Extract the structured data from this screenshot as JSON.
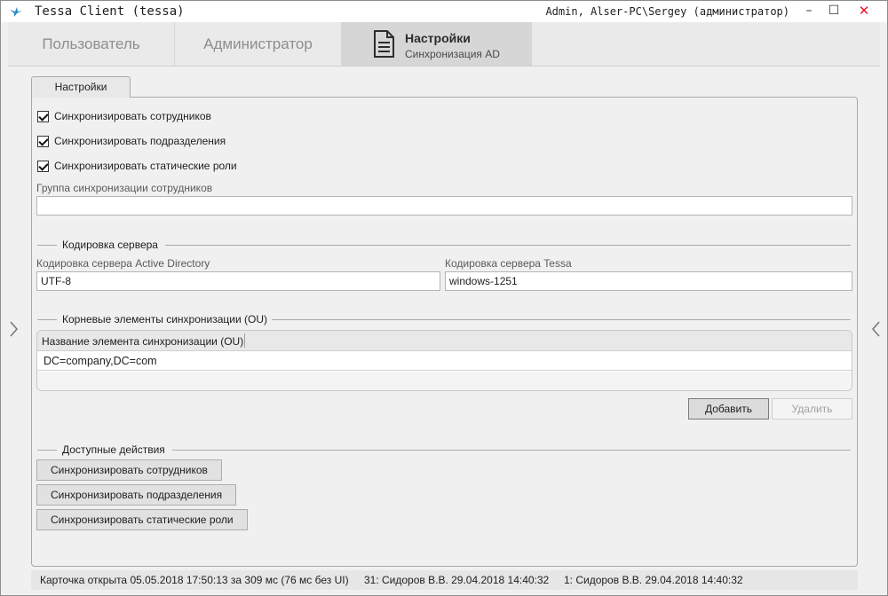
{
  "window": {
    "app_title": "Tessa Client (tessa)",
    "user_info": "Admin, Alser-PC\\Sergey (администратор)",
    "minimize": "–",
    "maximize": "☐",
    "close": "✕"
  },
  "header_tabs": {
    "user": "Пользователь",
    "admin": "Администратор",
    "settings_title": "Настройки",
    "settings_subtitle": "Синхронизация AD"
  },
  "nav": {
    "left_arrow": "‹",
    "right_arrow": "‹"
  },
  "content_tab": "Настройки",
  "checkboxes": [
    {
      "label": "Синхронизировать сотрудников",
      "checked": true
    },
    {
      "label": "Синхронизировать подразделения",
      "checked": true
    },
    {
      "label": "Синхронизировать статические роли",
      "checked": true
    }
  ],
  "sync_group": {
    "label": "Группа синхронизации сотрудников",
    "value": ""
  },
  "encoding": {
    "section_title": "Кодировка сервера",
    "ad_label": "Кодировка сервера Active Directory",
    "ad_value": "UTF-8",
    "tessa_label": "Кодировка сервера Tessa",
    "tessa_value": "windows-1251"
  },
  "roots": {
    "section_title": "Корневые элементы синхронизации (OU)",
    "column_title": "Название элемента синхронизации (OU)",
    "rows": [
      "DC=company,DC=com"
    ],
    "add_button": "Добавить",
    "delete_button": "Удалить"
  },
  "actions": {
    "section_title": "Доступные действия",
    "buttons": [
      "Синхронизировать сотрудников",
      "Синхронизировать подразделения",
      "Синхронизировать статические роли"
    ]
  },
  "status": {
    "opened": "Карточка открыта 05.05.2018 17:50:13 за 309 мс (76 мс без UI)",
    "version_31": "31:  Сидоров В.В.  29.04.2018 14:40:32",
    "version_1": "1:  Сидоров В.В.  29.04.2018 14:40:32"
  },
  "colors": {
    "accent_icon": "#2a8cc7",
    "close": "#e81123",
    "panel_bg": "#f0f0f0"
  }
}
